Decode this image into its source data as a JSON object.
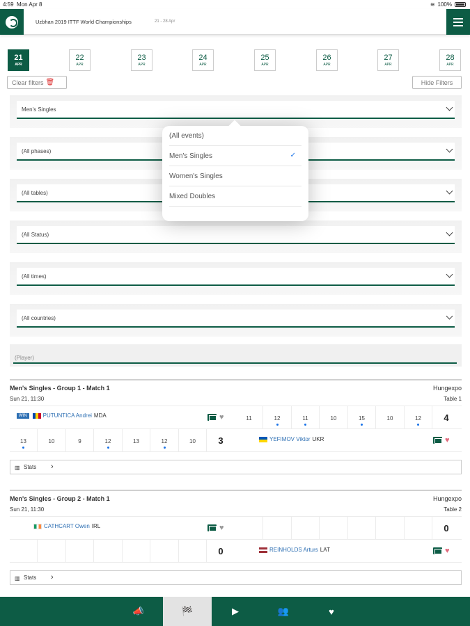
{
  "status_bar": {
    "time": "4:59",
    "date": "Mon Apr 8",
    "battery": "100%"
  },
  "header": {
    "title": "Uzbhan 2019 ITTF World Championships",
    "dates": "21 - 28 Apr",
    "logo_icon": "table-tennis-ball-icon",
    "menu_icon": "hamburger-menu-icon"
  },
  "days": [
    {
      "num": "21",
      "month": "APR",
      "active": true
    },
    {
      "num": "22",
      "month": "APR"
    },
    {
      "num": "23",
      "month": "APR"
    },
    {
      "num": "24",
      "month": "APR"
    },
    {
      "num": "25",
      "month": "APR"
    },
    {
      "num": "26",
      "month": "APR"
    },
    {
      "num": "27",
      "month": "APR"
    },
    {
      "num": "28",
      "month": "APR"
    }
  ],
  "buttons": {
    "clear_filters": "Clear filters",
    "hide_filters": "Hide Filters"
  },
  "filters": {
    "event": "Men's Singles",
    "phase": "(All phases)",
    "tables": "(All tables)",
    "status": "(All Status)",
    "times": "(All times)",
    "countries": "(All countries)",
    "player_placeholder": "(Player)"
  },
  "dropdown": {
    "options": [
      "(All events)",
      "Men's Singles",
      "Women's Singles",
      "Mixed Doubles"
    ],
    "selected_index": 1,
    "check": "✓"
  },
  "matches": [
    {
      "title": "Men's Singles - Group 1 - Match 1",
      "venue": "Hungexpo",
      "time": "Sun 21, 11:30",
      "table": "Table 1",
      "player1": {
        "badge": "WIN",
        "name": "PUTUNTICA Andrei",
        "country": "MDA",
        "scores": [
          "11",
          "12",
          "11",
          "10",
          "15",
          "10",
          "12"
        ],
        "dots": [
          false,
          true,
          true,
          false,
          true,
          false,
          true
        ],
        "total": "4"
      },
      "player2": {
        "name": "YEFIMOV Viktor",
        "country": "UKR",
        "scores": [
          "13",
          "10",
          "9",
          "12",
          "13",
          "12",
          "10"
        ],
        "dots": [
          true,
          false,
          false,
          true,
          false,
          true,
          false
        ],
        "total": "3"
      },
      "stats_label": "Stats"
    },
    {
      "title": "Men's Singles - Group 2 - Match 1",
      "venue": "Hungexpo",
      "time": "Sun 21, 11:30",
      "table": "Table 2",
      "player1": {
        "name": "CATHCART Owen",
        "country": "IRL",
        "total": "0"
      },
      "player2": {
        "name": "REINHOLDS Arturs",
        "country": "LAT",
        "total": "0"
      },
      "stats_label": "Stats"
    }
  ],
  "bottom_nav": [
    {
      "icon": "megaphone-icon",
      "glyph": "📣"
    },
    {
      "icon": "flags-icon",
      "glyph": "🏁",
      "active": true
    },
    {
      "icon": "play-icon",
      "glyph": "▶"
    },
    {
      "icon": "players-icon",
      "glyph": "👥"
    },
    {
      "icon": "heart-icon",
      "glyph": "♥"
    }
  ]
}
